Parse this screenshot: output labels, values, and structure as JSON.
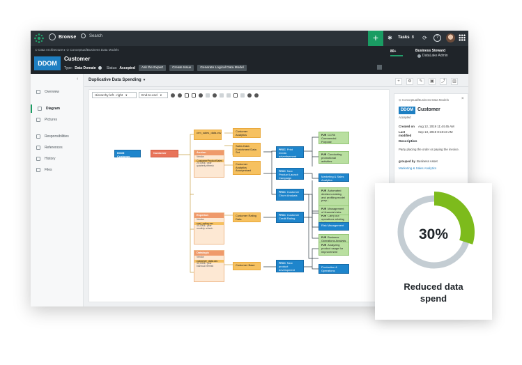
{
  "colors": {
    "brand": "#1a9c63",
    "ddom": "#1e7fc2",
    "topbar": "#2b3238",
    "header": "#1f2429",
    "donut_fill": "#7dbb1c",
    "donut_track": "#c4cdd3"
  },
  "topbar": {
    "browse": "Browse",
    "search_placeholder": "Search",
    "tasks_label": "Tasks",
    "tasks_count": "8"
  },
  "header": {
    "breadcrumb": "⊙ Data Architecture ▸ ⊙ Conceptual/Business Data Models",
    "badge": "DDOM",
    "title": "Customer",
    "type_label": "Type:",
    "type_value": "Data Domain",
    "status_label": "Status:",
    "status_value": "Accepted",
    "buttons": [
      "Ask the Expert",
      "Create Issue",
      "Generate Logical Data Model"
    ],
    "stat": "80+",
    "steward_role": "Business Steward",
    "steward_name": "DataLake Admin"
  },
  "sidenav": {
    "items": [
      {
        "label": "Overview",
        "icon": "overview-icon"
      },
      {
        "label": "Diagram",
        "icon": "diagram-icon",
        "active": true
      },
      {
        "label": "Pictures",
        "icon": "pictures-icon"
      },
      {
        "label": "Responsibilities",
        "icon": "responsibilities-icon"
      },
      {
        "label": "References",
        "icon": "references-icon"
      },
      {
        "label": "History",
        "icon": "history-icon"
      },
      {
        "label": "Files",
        "icon": "files-icon"
      }
    ]
  },
  "main": {
    "tab": "Duplicative Data Spending",
    "layout_select": "Hierarchy left - right",
    "depth_select": "End-to-end"
  },
  "diagram": {
    "nodes": {
      "root_tag": "DDOM",
      "root": "Customer",
      "crm": "crm_sales_data.csv",
      "cust_analytics": "Customer Analytics",
      "sales_data": "Sales Data Enrichment Data Set",
      "auxion_head": "Auxion",
      "auxion_sub": "Vendor",
      "auxion_item": "CustomerProductSales",
      "auxion_cost": "20,000$ / year",
      "auxion_freq": "quarterly refresh",
      "cust_anon": "Customer Analytics Anonymised",
      "print_media": "Print media advertisement",
      "new_product": "New Product Launch Campaign",
      "churn": "Customer Churn Analysis",
      "ccpa": "CCPA Commercial Purpose",
      "promo": "Conducting promotional activities",
      "mkt": "Marketing & Sales Analytics",
      "auto": "Automated decision-making and profiling model prep...",
      "carry": "Carry out operations relating to the selection of...",
      "bizops": "Business Operations Analysis",
      "experian_head": "Experian",
      "experian_sub": "Vendor",
      "experian_item": "cust_rating.csv",
      "experian_cost": "40,000$ / year",
      "experian_freq": "monthly refresh",
      "rating": "Customer Rating Data",
      "credit": "Customer Credit Rating",
      "fin_risk": "Management of financial risks",
      "risk": "Risk Management",
      "datalogic_head": "Datalogic",
      "datalogic_sub": "Vendor",
      "datalogic_item": "customer_data.csv",
      "datalogic_cost": "30,000$ / year",
      "datalogic_freq": "biannual refresh",
      "cust_base": "Customer Base",
      "npd": "New product development process",
      "usage": "Analyzing product usage for improvement",
      "prodops": "Production & Operations",
      "proc": "PROC",
      "pur": "PUR"
    }
  },
  "rpanel": {
    "crumb": "⊙ Conceptual/Business Data Models",
    "badge": "DDOM",
    "title": "Customer",
    "status": "Accepted",
    "created_label": "Created on",
    "created_value": "Aug 12, 2019 11:44:45 AM",
    "modified_label": "Last modified",
    "modified_value": "Sep 13, 2019 8:18:43 AM",
    "desc_label": "Description",
    "desc_text": "Party placing the order or paying the invoice.",
    "grouped_label": "grouped by",
    "grouped_value": "Business Asset",
    "link": "Marketing & Sales Analytics"
  },
  "stat_card": {
    "percent_text": "30%",
    "percent_value": 0.3,
    "caption_line1": "Reduced data",
    "caption_line2": "spend"
  }
}
